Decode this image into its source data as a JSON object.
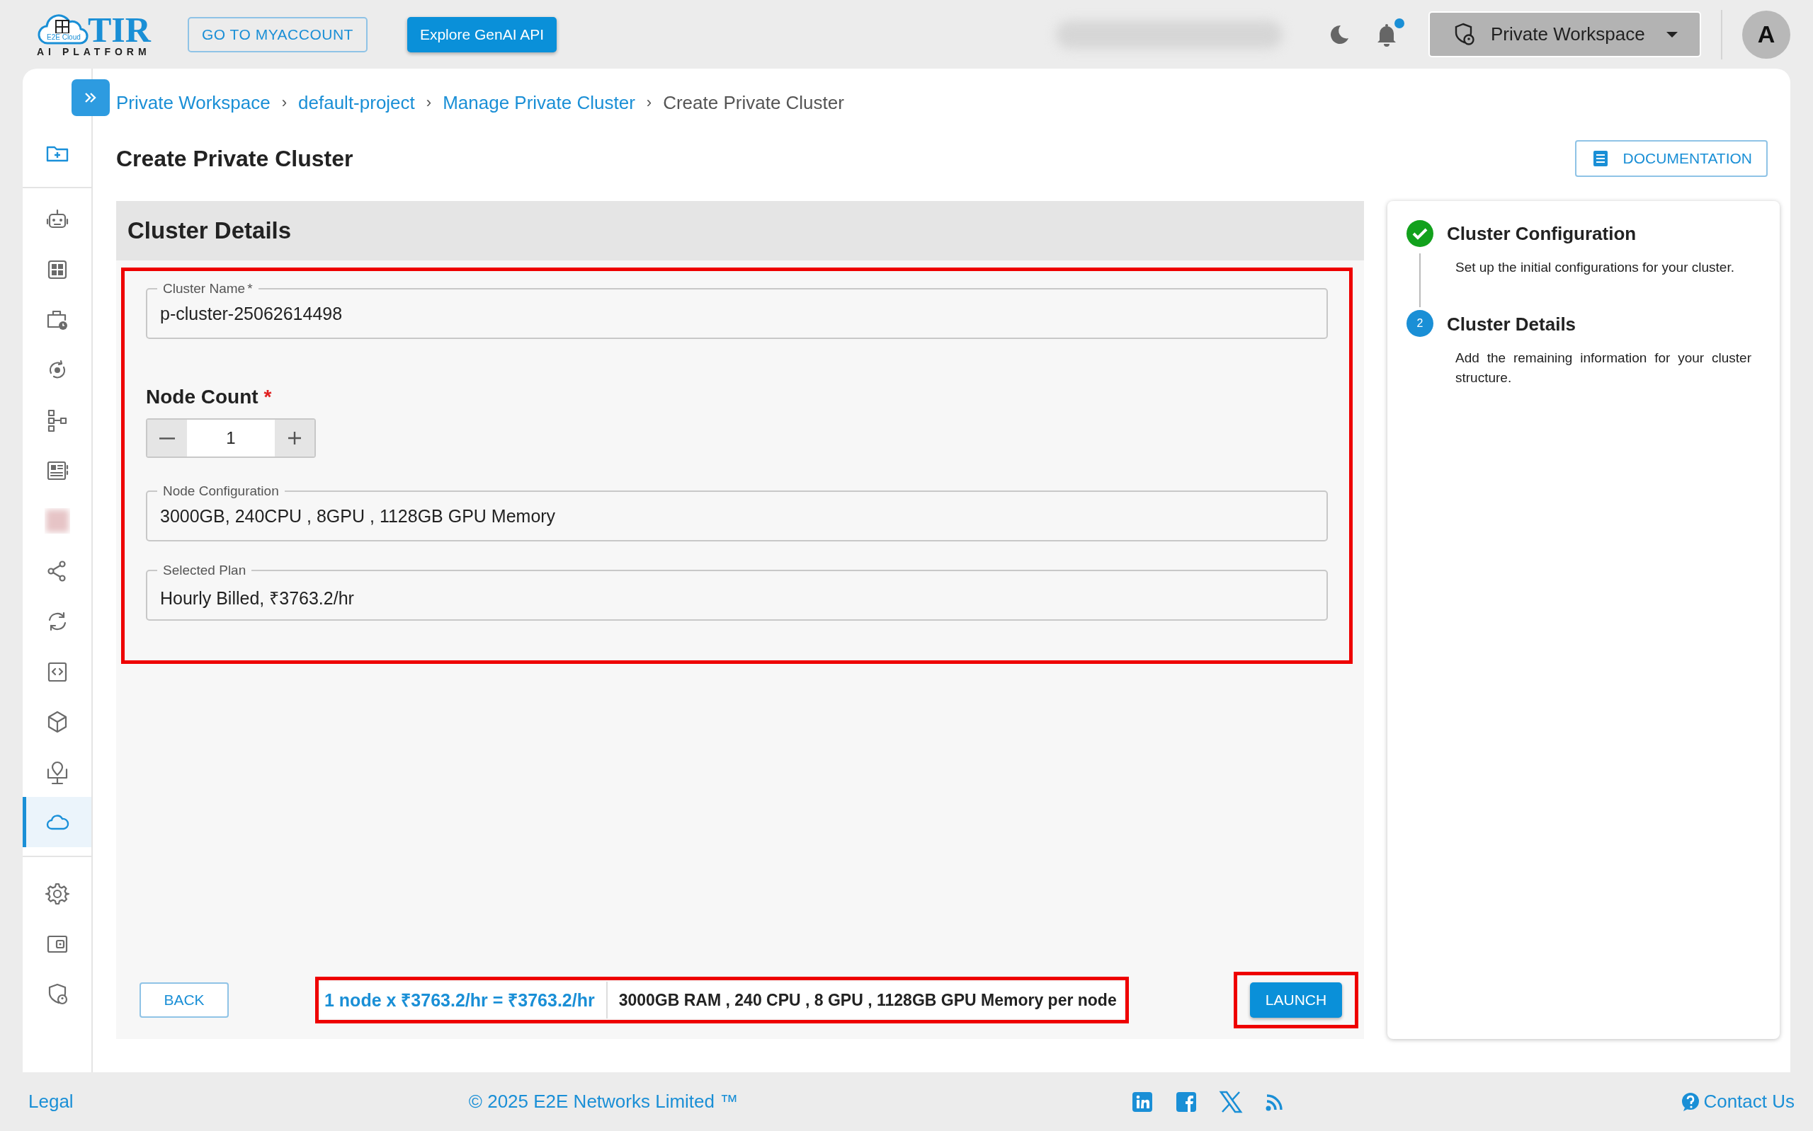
{
  "header": {
    "logo": {
      "name": "TIR",
      "tagline": "AI PLATFORM",
      "badge": "E2E Cloud"
    },
    "buttons": [
      {
        "label": "GO TO MYACCOUNT",
        "kind": "outlined"
      },
      {
        "label": "Explore GenAI API",
        "kind": "filled"
      }
    ],
    "notifications": {
      "unread": true
    },
    "workspace": {
      "label": "Private Workspace"
    },
    "avatar": "A"
  },
  "sidebar": {
    "sections": [
      {
        "items": [
          {
            "selected": false
          }
        ]
      },
      {
        "items": [
          {
            "selected": false
          },
          {
            "selected": false
          },
          {
            "selected": false
          },
          {
            "selected": false
          },
          {
            "selected": false
          },
          {
            "selected": false
          },
          {
            "selected": false
          },
          {
            "selected": false
          },
          {
            "selected": false
          },
          {
            "selected": false
          },
          {
            "selected": false
          },
          {
            "selected": false
          },
          {
            "selected": true
          }
        ]
      },
      {
        "items": [
          {
            "selected": false
          },
          {
            "selected": false
          },
          {
            "selected": false
          }
        ]
      }
    ]
  },
  "breadcrumb_separator": "›",
  "breadcrumb": [
    {
      "label": "Private Workspace",
      "link": true
    },
    {
      "label": "default-project",
      "link": true
    },
    {
      "label": "Manage Private Cluster",
      "link": true
    },
    {
      "label": "Create Private Cluster",
      "link": false
    }
  ],
  "page_title": "Create Private Cluster",
  "documentation_button": "DOCUMENTATION",
  "form": {
    "title": "Cluster Details",
    "cluster_name": {
      "label": "Cluster Name",
      "required_mark": "*",
      "value": "p-cluster-25062614498"
    },
    "node_count": {
      "label": "Node Count",
      "required_mark": "*",
      "value": "1"
    },
    "node_configuration": {
      "label": "Node Configuration",
      "value": "3000GB, 240CPU , 8GPU , 1128GB GPU Memory"
    },
    "selected_plan": {
      "label": "Selected Plan",
      "value": "Hourly Billed, ₹3763.2/hr"
    }
  },
  "footer_bar": {
    "back": "BACK",
    "price": "1 node x ₹3763.2/hr = ₹3763.2/hr",
    "specs": "3000GB RAM , 240 CPU , 8 GPU , 1128GB GPU Memory per node",
    "launch": "LAUNCH"
  },
  "steps": [
    {
      "title": "Cluster Configuration",
      "description": "Set up the initial configurations for your cluster.",
      "completed": true
    },
    {
      "title": "Cluster Details",
      "description": "Add the remaining information for your cluster structure.",
      "completed": false,
      "number": "2"
    }
  ],
  "footer": {
    "legal": "Legal",
    "copyright": "© 2025 E2E Networks Limited ™",
    "contact": "Contact Us"
  }
}
